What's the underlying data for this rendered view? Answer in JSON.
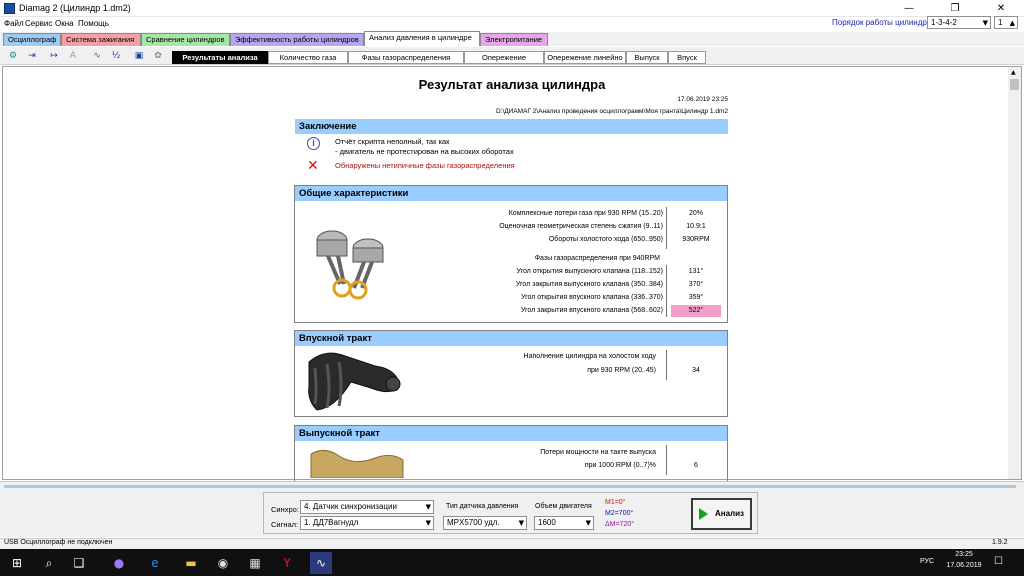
{
  "window": {
    "title": "Diamag 2 (Цилиндр 1.dm2)",
    "minimize": "—",
    "maximize": "❐",
    "close": "✕"
  },
  "menu": [
    "Файл",
    "Сервис",
    "Окна",
    "Помощь"
  ],
  "cylinder_order": {
    "label": "Порядок работы цилиндров",
    "value": "1-3-4-2",
    "spinner": "1"
  },
  "main_tabs": [
    {
      "label": "Осциллограф",
      "color": "#9ecbf2"
    },
    {
      "label": "Система зажигания",
      "color": "#f5a0a8"
    },
    {
      "label": "Сравнение цилиндров",
      "color": "#a6e6a6"
    },
    {
      "label": "Эффективность работы цилиндров",
      "color": "#b6a6f0"
    },
    {
      "label": "Анализ давления в цилиндре",
      "color": "#ffffff"
    },
    {
      "label": "Электропитание",
      "color": "#e6a6e8"
    }
  ],
  "sub_tabs": [
    "Результаты анализа",
    "Количество газа",
    "Фазы газораспределения",
    "Опережение",
    "Опережение линейно",
    "Выпуск",
    "Впуск"
  ],
  "report": {
    "title": "Результат анализа цилиндра",
    "date": "17.06.2019 23:25",
    "path": "D:\\ДИАМАГ 2\\Анализ проведения осциллограмм\\Моя гранта\\Цилиндр 1.dm2",
    "conclusion": {
      "header": "Заключение",
      "info_line1": "Отчёт скрипта неполный, так как",
      "info_line2": "- двигатель не протестирован на высоких оборотах",
      "error_text": "Обнаружены нетипичные фазы газораспределения",
      "info_icon": "i",
      "error_icon": "✕"
    },
    "general": {
      "header": "Общие характеристики",
      "rows": [
        {
          "label": "Комплексные потери газа при 930 RPM (15..20)",
          "value": "20%"
        },
        {
          "label": "Оценочная геометрическая степень сжатия (9..11)",
          "value": "10.9:1"
        },
        {
          "label": "Обороты холостого хода (650..950)",
          "value": "930RPM"
        }
      ],
      "phases_title": "Фазы газораспределения при 940RPM",
      "phases": [
        {
          "label": "Угол открытия выпускного клапана (118..152)",
          "value": "131°"
        },
        {
          "label": "Угол закрытия выпускного клапана (350..384)",
          "value": "370°"
        },
        {
          "label": "Угол открытия впускного клапана (336..370)",
          "value": "359°"
        },
        {
          "label": "Угол закрытия впускного клапана (568..602)",
          "value": "522°"
        }
      ]
    },
    "intake": {
      "header": "Впускной тракт",
      "line1": "Наполнение цилиндра на холостом ходу",
      "line2": "при 930 RPM (20..45)",
      "value": "34"
    },
    "exhaust": {
      "header": "Выпускной тракт",
      "line1": "Потери мощности на такте выпуска",
      "line2": "при  1000 RPM (0..7)%",
      "value": "6"
    }
  },
  "controls": {
    "sync_label": "Синхро:",
    "sync_value": "4.  Датчик синхронизации",
    "signal_label": "Сигнал:",
    "signal_value": "1.  ДД7Вагнудл",
    "sensor_label": "Тип датчика давления",
    "sensor_value": "MPX5700 удл.",
    "engine_label": "Объем двигателя",
    "engine_value": "1600",
    "m1": "M1=0°",
    "m2": "M2=700°",
    "dm": "ΔM=720°",
    "analyze_button": "Анализ"
  },
  "status": {
    "left": "USB Осциллограф не подключен",
    "version": "1.9.2"
  },
  "taskbar": {
    "time": "23:25",
    "date": "17.06.2019",
    "lang": "РУС"
  }
}
